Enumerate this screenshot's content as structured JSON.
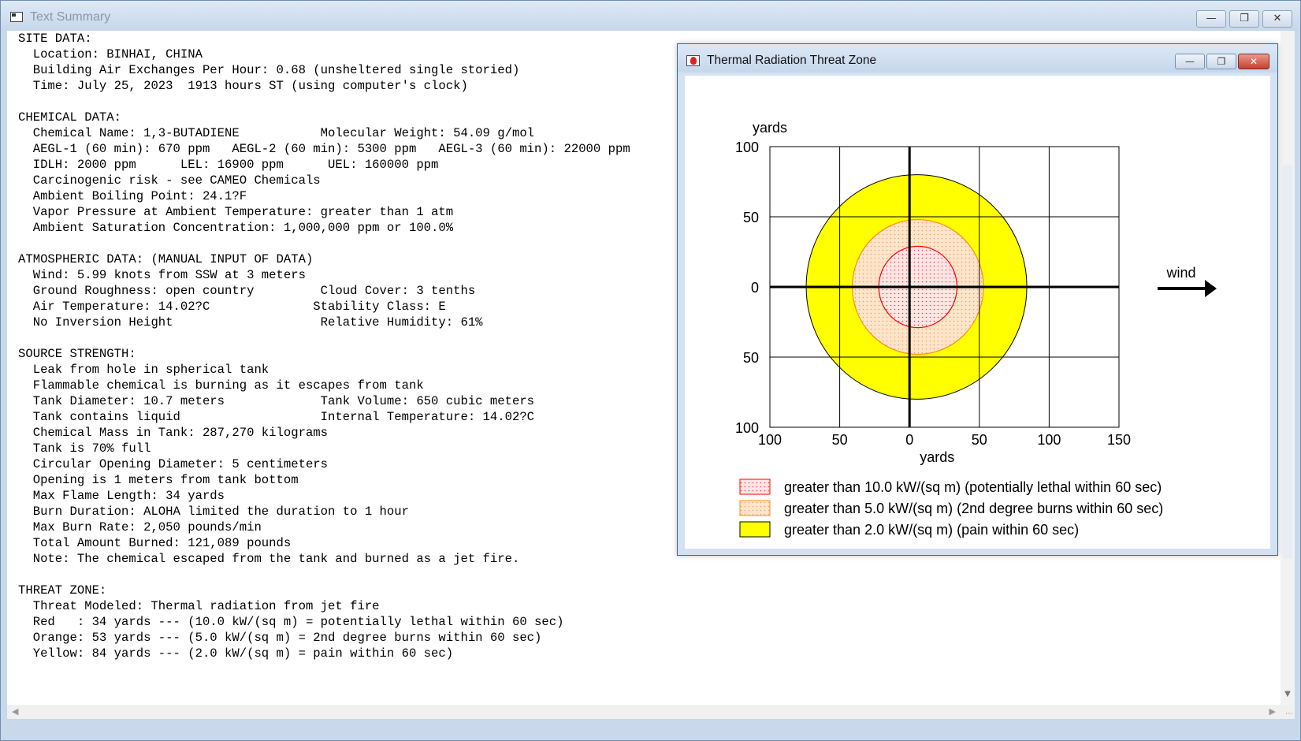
{
  "main_window": {
    "title": "Text Summary",
    "buttons": {
      "minimize": "—",
      "restore": "❐",
      "close": "✕"
    }
  },
  "summary_lines": [
    "SITE DATA:",
    "  Location: BINHAI, CHINA",
    "  Building Air Exchanges Per Hour: 0.68 (unsheltered single storied)",
    "  Time: July 25, 2023  1913 hours ST (using computer's clock)",
    "",
    "CHEMICAL DATA:",
    "  Chemical Name: 1,3-BUTADIENE           Molecular Weight: 54.09 g/mol",
    "  AEGL-1 (60 min): 670 ppm   AEGL-2 (60 min): 5300 ppm   AEGL-3 (60 min): 22000 ppm",
    "  IDLH: 2000 ppm      LEL: 16900 ppm      UEL: 160000 ppm",
    "  Carcinogenic risk - see CAMEO Chemicals",
    "  Ambient Boiling Point: 24.1?F",
    "  Vapor Pressure at Ambient Temperature: greater than 1 atm",
    "  Ambient Saturation Concentration: 1,000,000 ppm or 100.0%",
    "",
    "ATMOSPHERIC DATA: (MANUAL INPUT OF DATA)",
    "  Wind: 5.99 knots from SSW at 3 meters",
    "  Ground Roughness: open country         Cloud Cover: 3 tenths",
    "  Air Temperature: 14.02?C              Stability Class: E",
    "  No Inversion Height                    Relative Humidity: 61%",
    "",
    "SOURCE STRENGTH:",
    "  Leak from hole in spherical tank",
    "  Flammable chemical is burning as it escapes from tank",
    "  Tank Diameter: 10.7 meters             Tank Volume: 650 cubic meters",
    "  Tank contains liquid                   Internal Temperature: 14.02?C",
    "  Chemical Mass in Tank: 287,270 kilograms",
    "  Tank is 70% full",
    "  Circular Opening Diameter: 5 centimeters",
    "  Opening is 1 meters from tank bottom",
    "  Max Flame Length: 34 yards",
    "  Burn Duration: ALOHA limited the duration to 1 hour",
    "  Max Burn Rate: 2,050 pounds/min",
    "  Total Amount Burned: 121,089 pounds",
    "  Note: The chemical escaped from the tank and burned as a jet fire.",
    "",
    "THREAT ZONE:",
    "  Threat Modeled: Thermal radiation from jet fire",
    "  Red   : 34 yards --- (10.0 kW/(sq m) = potentially lethal within 60 sec)",
    "  Orange: 53 yards --- (5.0 kW/(sq m) = 2nd degree burns within 60 sec)",
    "  Yellow: 84 yards --- (2.0 kW/(sq m) = pain within 60 sec)"
  ],
  "threat_window": {
    "title": "Thermal Radiation Threat Zone",
    "buttons": {
      "minimize": "—",
      "restore": "❐",
      "close": "✕"
    }
  },
  "chart_data": {
    "type": "threat-zone-plot",
    "xlabel": "yards",
    "ylabel": "yards",
    "xlim": [
      -100,
      150
    ],
    "ylim": [
      -100,
      100
    ],
    "grid": true,
    "x_ticks": [
      -100,
      -50,
      0,
      50,
      100,
      150
    ],
    "x_tick_labels": [
      "100",
      "50",
      "0",
      "50",
      "100",
      "150"
    ],
    "y_ticks": [
      100,
      50,
      0,
      -50,
      -100
    ],
    "y_tick_labels": [
      "100",
      "50",
      "0",
      "50",
      "100"
    ],
    "wind_label": "wind",
    "zones": [
      {
        "name": "yellow",
        "color": "#ffff00",
        "stroke": "#000000",
        "pattern": "solid",
        "x_min": -74,
        "x_max": 84,
        "y_max": 80,
        "y_min": -80
      },
      {
        "name": "orange",
        "color": "#fde3c6",
        "stroke": "#ff8c1a",
        "pattern": "dotted",
        "x_min": -41,
        "x_max": 53,
        "y_max": 48,
        "y_min": -48
      },
      {
        "name": "red",
        "color": "#ffe4e4",
        "stroke": "#ff0000",
        "pattern": "dotted",
        "x_min": -22,
        "x_max": 34,
        "y_max": 29,
        "y_min": -29
      }
    ],
    "legend": [
      {
        "label": "greater than 10.0 kW/(sq m) (potentially lethal within 60 sec)",
        "zone": "red"
      },
      {
        "label": "greater than 5.0 kW/(sq m) (2nd degree burns within 60 sec)",
        "zone": "orange"
      },
      {
        "label": "greater than 2.0 kW/(sq m) (pain within 60 sec)",
        "zone": "yellow"
      }
    ]
  }
}
